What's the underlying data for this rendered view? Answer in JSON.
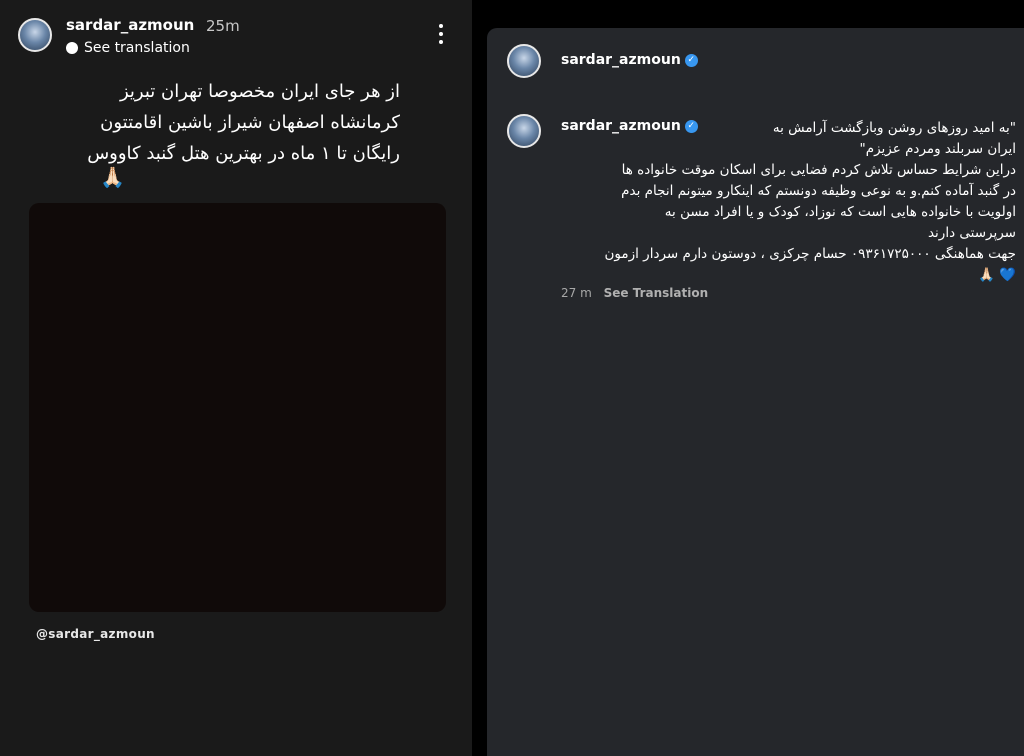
{
  "story": {
    "username": "sardar_azmoun",
    "time": "25m",
    "see_translation": "See translation",
    "text_lines": [
      "از هر جای ایران مخصوصا تهران تبریز",
      "کرمانشاه اصفهان شیراز باشین اقامتتون",
      "رایگان تا ۱ ماه در بهترین هتل گنبد کاووس"
    ],
    "emoji": "🙏🏻",
    "mention": "@sardar_azmoun"
  },
  "post": {
    "username": "sardar_azmoun",
    "caption_username": "sardar_azmoun",
    "caption_lines": [
      "\"به امید روزهای روشن وبازگشت آرامش به",
      "ایران سربلند ومردم عزیزم\"",
      "دراین شرایط حساس تلاش کردم فضایی برای اسکان موقت خانواده ها",
      "در گنبد آماده کنم.و به نوعی وظیفه دونستم که اینکارو میتونم انجام بدم",
      "اولویت با خانواده هایی است که نوزاد، کودک و یا افراد مسن به",
      "سرپرستی دارند",
      "جهت هماهنگی ۰۹۳۶۱۷۲۵۰۰۰ حسام چرکزی ، دوستون دارم سردار ازمون"
    ],
    "caption_emoji": "🙏🏻",
    "caption_heart": "💙",
    "time": "27 m",
    "see_translation": "See Translation"
  }
}
